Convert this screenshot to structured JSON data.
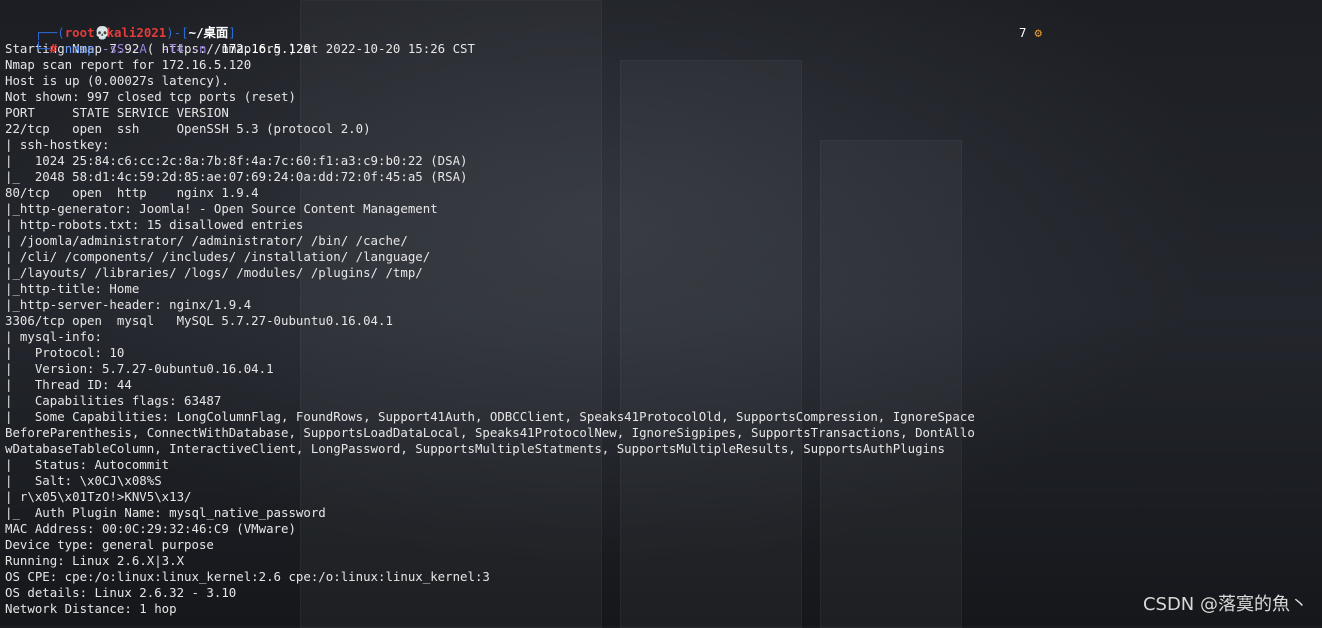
{
  "prompt": {
    "open": "┌──(",
    "user": "root",
    "skull_icon": "💀",
    "host": "kali2021",
    "mid": ")-[",
    "dir": "~/桌面",
    "close": "]",
    "line2": "└─",
    "hash": "#",
    "command": "nmap",
    "flags": "-sS -A  -T4 -n",
    "target": "172.16.5.120",
    "job_count": "7",
    "gear_icon": "⚙"
  },
  "output": [
    "Starting Nmap 7.92 ( https://nmap.org ) at 2022-10-20 15:26 CST",
    "Nmap scan report for 172.16.5.120",
    "Host is up (0.00027s latency).",
    "Not shown: 997 closed tcp ports (reset)",
    "PORT     STATE SERVICE VERSION",
    "22/tcp   open  ssh     OpenSSH 5.3 (protocol 2.0)",
    "| ssh-hostkey:",
    "|   1024 25:84:c6:cc:2c:8a:7b:8f:4a:7c:60:f1:a3:c9:b0:22 (DSA)",
    "|_  2048 58:d1:4c:59:2d:85:ae:07:69:24:0a:dd:72:0f:45:a5 (RSA)",
    "80/tcp   open  http    nginx 1.9.4",
    "|_http-generator: Joomla! - Open Source Content Management",
    "| http-robots.txt: 15 disallowed entries",
    "| /joomla/administrator/ /administrator/ /bin/ /cache/",
    "| /cli/ /components/ /includes/ /installation/ /language/",
    "|_/layouts/ /libraries/ /logs/ /modules/ /plugins/ /tmp/",
    "|_http-title: Home",
    "|_http-server-header: nginx/1.9.4",
    "3306/tcp open  mysql   MySQL 5.7.27-0ubuntu0.16.04.1",
    "| mysql-info:",
    "|   Protocol: 10",
    "|   Version: 5.7.27-0ubuntu0.16.04.1",
    "|   Thread ID: 44",
    "|   Capabilities flags: 63487",
    "|   Some Capabilities: LongColumnFlag, FoundRows, Support41Auth, ODBCClient, Speaks41ProtocolOld, SupportsCompression, IgnoreSpace",
    "BeforeParenthesis, ConnectWithDatabase, SupportsLoadDataLocal, Speaks41ProtocolNew, IgnoreSigpipes, SupportsTransactions, DontAllo",
    "wDatabaseTableColumn, InteractiveClient, LongPassword, SupportsMultipleStatments, SupportsMultipleResults, SupportsAuthPlugins",
    "|   Status: Autocommit",
    "|   Salt: \\x0CJ\\x08%S",
    "| r\\x05\\x01TzO!>KNV5\\x13/",
    "|_  Auth Plugin Name: mysql_native_password",
    "MAC Address: 00:0C:29:32:46:C9 (VMware)",
    "Device type: general purpose",
    "Running: Linux 2.6.X|3.X",
    "OS CPE: cpe:/o:linux:linux_kernel:2.6 cpe:/o:linux:linux_kernel:3",
    "OS details: Linux 2.6.32 - 3.10",
    "Network Distance: 1 hop"
  ],
  "watermark": "CSDN @落寞的魚丶"
}
